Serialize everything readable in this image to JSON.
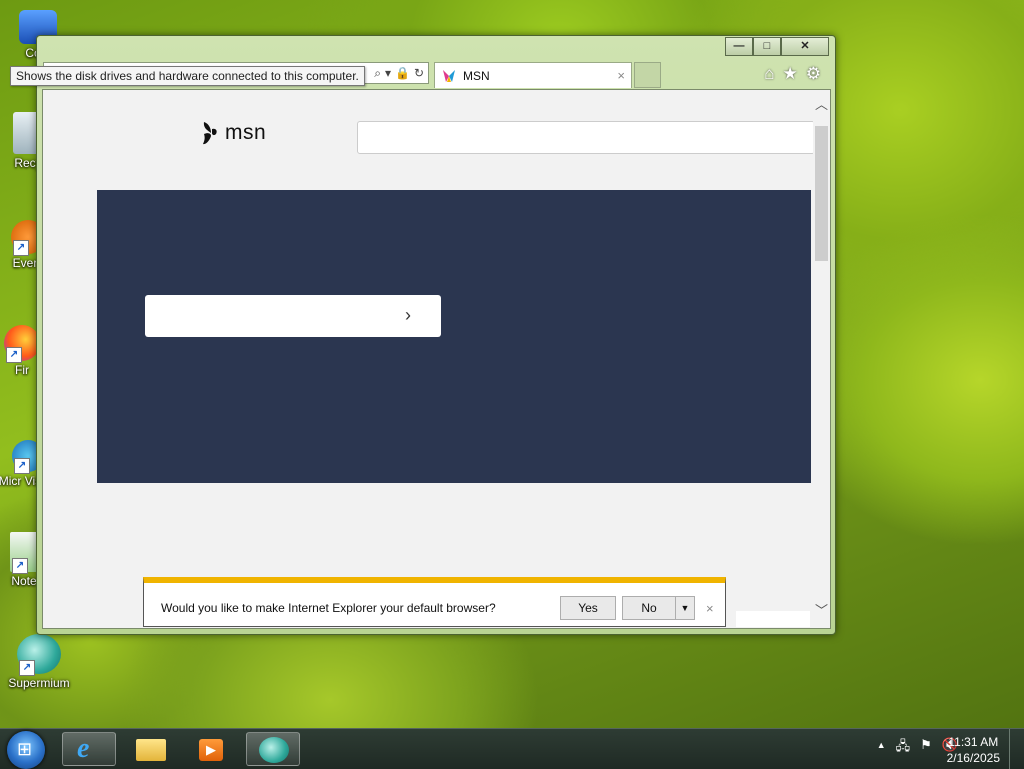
{
  "desktop": {
    "icons": [
      {
        "label": "Com"
      },
      {
        "label": "Recy"
      },
      {
        "label": "Every"
      },
      {
        "label": "Fir"
      },
      {
        "label": "Micr Visual"
      },
      {
        "label": "Note"
      },
      {
        "label": "Supermium"
      }
    ],
    "tooltip": "Shows the disk drives and hardware connected to this computer."
  },
  "browser": {
    "tab_title": "MSN",
    "tab_close": "×",
    "caption": {
      "minimize": "—",
      "maximize": "□",
      "close": "✕"
    },
    "address_icons": [
      "search-icon",
      "dropdown-icon",
      "lock-icon",
      "refresh-icon"
    ],
    "toolbar_icons": {
      "home": "⌂",
      "favorites": "★",
      "settings": "⚙"
    },
    "page": {
      "logo_text": "msn",
      "search_placeholder": "",
      "hero_chevron": "›"
    },
    "notification": {
      "message": "Would you like to make Internet Explorer your default browser?",
      "yes": "Yes",
      "no": "No",
      "dropdown": "▼",
      "close": "×"
    }
  },
  "taskbar": {
    "apps": [
      "internet-explorer",
      "file-explorer",
      "media-player",
      "supermium"
    ],
    "tray": {
      "show_hidden": "▲"
    },
    "clock": {
      "time": "11:31 AM",
      "date": "2/16/2025"
    }
  },
  "colors": {
    "hero_bg": "#2b3650",
    "notification_accent": "#f0b400",
    "window_frame": "#c6dca4"
  }
}
